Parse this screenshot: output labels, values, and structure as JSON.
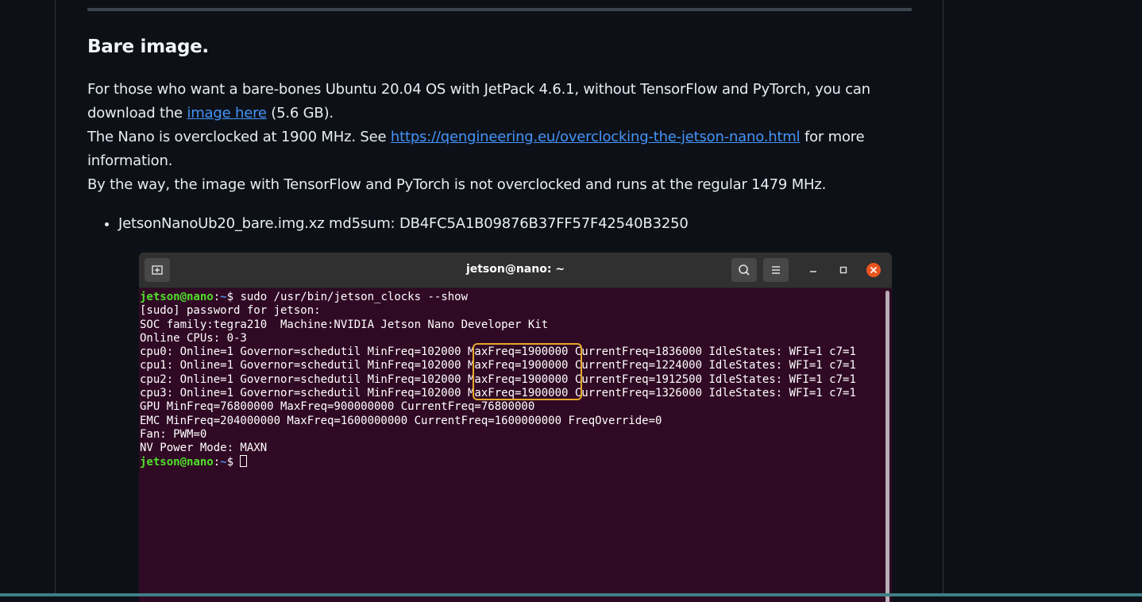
{
  "heading": "Bare image.",
  "paragraph": {
    "line1": "For those who want a bare-bones Ubuntu 20.04 OS with JetPack 4.6.1, without TensorFlow and PyTorch, you can download the ",
    "link1": "image here",
    "line1_end": " (5.6 GB).",
    "line2_start": "The Nano is overclocked at 1900 MHz. See ",
    "link2": "https://qengineering.eu/overclocking-the-jetson-nano.html",
    "line2_end": " for more information.",
    "line3": "By the way, the image with TensorFlow and PyTorch is not overclocked and runs at the regular 1479 MHz."
  },
  "list_item": "JetsonNanoUb20_bare.img.xz md5sum: DB4FC5A1B09876B37FF57F42540B3250",
  "terminal": {
    "title": "jetson@nano: ~",
    "prompt_user": "jetson@nano",
    "prompt_sep": ":",
    "prompt_path": "~",
    "prompt_dollar": "$ ",
    "command": "sudo /usr/bin/jetson_clocks --show",
    "lines": [
      "[sudo] password for jetson:",
      "SOC family:tegra210  Machine:NVIDIA Jetson Nano Developer Kit",
      "Online CPUs: 0-3",
      "cpu0: Online=1 Governor=schedutil MinFreq=102000 MaxFreq=1900000 CurrentFreq=1836000 IdleStates: WFI=1 c7=1",
      "cpu1: Online=1 Governor=schedutil MinFreq=102000 MaxFreq=1900000 CurrentFreq=1224000 IdleStates: WFI=1 c7=1",
      "cpu2: Online=1 Governor=schedutil MinFreq=102000 MaxFreq=1900000 CurrentFreq=1912500 IdleStates: WFI=1 c7=1",
      "cpu3: Online=1 Governor=schedutil MinFreq=102000 MaxFreq=1900000 CurrentFreq=1326000 IdleStates: WFI=1 c7=1",
      "GPU MinFreq=76800000 MaxFreq=900000000 CurrentFreq=76800000",
      "EMC MinFreq=204000000 MaxFreq=1600000000 CurrentFreq=1600000000 FreqOverride=0",
      "Fan: PWM=0",
      "NV Power Mode: MAXN"
    ],
    "icons": {
      "new_tab": "new-tab-icon",
      "search": "search-icon",
      "menu": "hamburger-menu-icon",
      "minimize": "minimize-icon",
      "maximize": "maximize-icon",
      "close": "close-icon"
    },
    "colors": {
      "background": "#300a24",
      "prompt_user": "#4fe02a",
      "prompt_path": "#4b8fe8",
      "highlight": "#e6a72a",
      "close_button": "#e95420"
    }
  },
  "colors": {
    "page_background": "#0d1117",
    "text": "#e6edf3",
    "link": "#4493f8"
  }
}
